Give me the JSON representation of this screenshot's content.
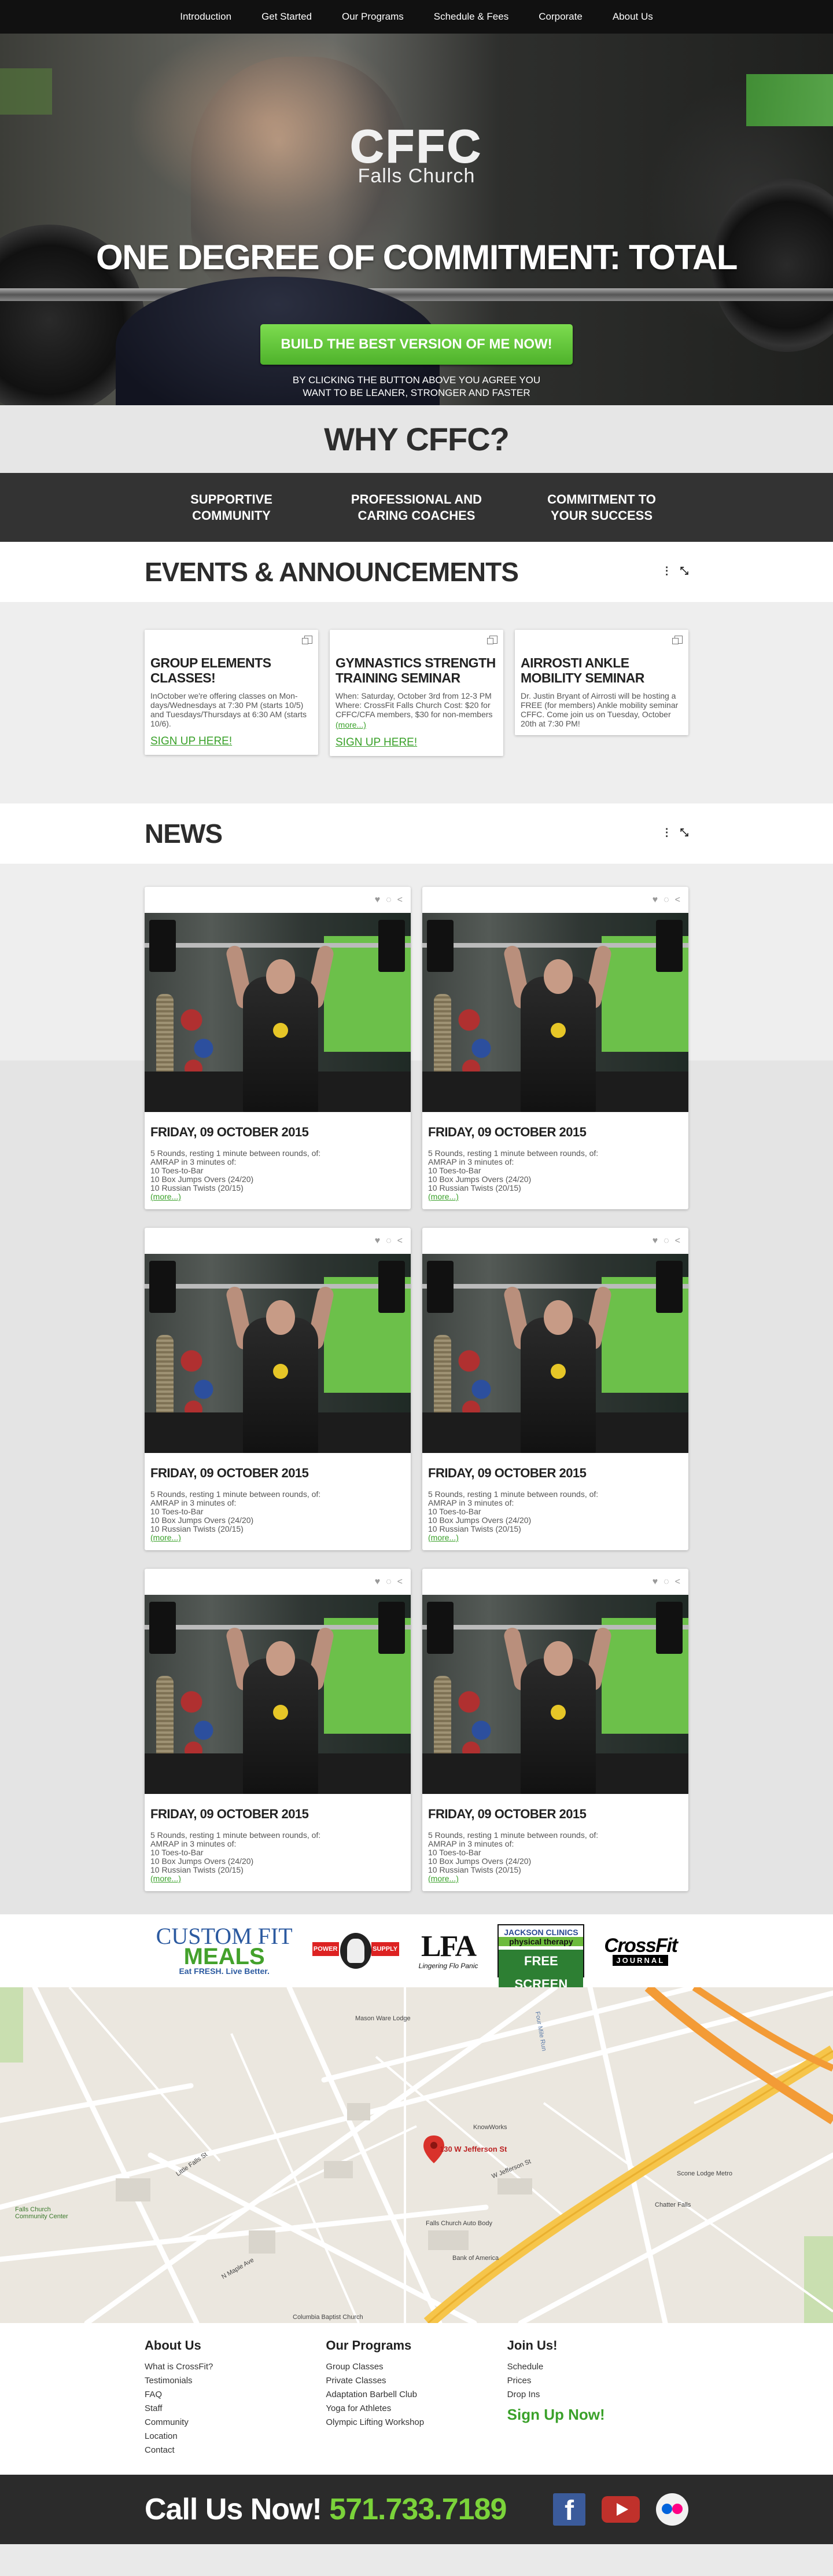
{
  "nav": {
    "items": [
      "Introduction",
      "Get Started",
      "Our Programs",
      "Schedule & Fees",
      "Corporate",
      "About Us"
    ]
  },
  "hero": {
    "logo_letters": "CFFC",
    "logo_sub": "Falls Church",
    "title": "ONE DEGREE OF COMMITMENT: TOTAL",
    "cta": "BUILD THE BEST VERSION OF ME NOW!",
    "note_line1": "BY CLICKING THE BUTTON ABOVE YOU AGREE YOU",
    "note_line2": "WANT TO BE LEANER, STRONGER AND FASTER"
  },
  "why": {
    "title": "WHY CFFC?",
    "pillars": [
      {
        "l1": "SUPPORTIVE",
        "l2": "COMMUNITY"
      },
      {
        "l1": "PROFESSIONAL AND",
        "l2": "CARING COACHES"
      },
      {
        "l1": "COMMITMENT TO",
        "l2": "YOUR SUCCESS"
      }
    ]
  },
  "events": {
    "title": "EVENTS & ANNOUNCEMENTS",
    "items": [
      {
        "title": "GROUP ELEMENTS CLASSES!",
        "body": "InOctober we're offering classes on Mon-days/Wednesdays at 7:30 PM (starts 10/5) and Tuesdays/Thursdays at 6:30 AM (starts 10/6).",
        "more": "",
        "signup": "SIGN UP HERE!"
      },
      {
        "title": "GYMNASTICS STRENGTH TRAINING SEMINAR",
        "body": "When: Saturday, October 3rd from 12-3 PM Where: CrossFit Falls Church Cost: $20 for CFFC/CFA members, $30 for non-members",
        "more": "(more...)",
        "signup": "SIGN UP HERE!"
      },
      {
        "title": "AIRROSTI ANKLE MOBILITY SEMINAR",
        "body": "Dr. Justin Bryant of Airrosti will be hosting a FREE (for members) Ankle mobility seminar CFFC. Come join us on Tuesday, October 20th at 7:30 PM!",
        "more": "",
        "signup": ""
      }
    ]
  },
  "news": {
    "title": "NEWS",
    "posts": [
      {
        "date": "FRIDAY, 09 OCTOBER 2015",
        "l1": "5 Rounds, resting 1 minute between rounds, of:",
        "l2": "AMRAP in 3 minutes of:",
        "l3": "10 Toes-to-Bar",
        "l4": "10 Box Jumps Overs (24/20)",
        "l5": "10 Russian Twists (20/15)",
        "more": "(more...)"
      },
      {
        "date": "FRIDAY, 09 OCTOBER 2015",
        "l1": "5 Rounds, resting 1 minute between rounds, of:",
        "l2": "AMRAP in 3 minutes of:",
        "l3": "10 Toes-to-Bar",
        "l4": "10 Box Jumps Overs (24/20)",
        "l5": "10 Russian Twists (20/15)",
        "more": "(more...)"
      },
      {
        "date": "FRIDAY, 09 OCTOBER 2015",
        "l1": "5 Rounds, resting 1 minute between rounds, of:",
        "l2": "AMRAP in 3 minutes of:",
        "l3": "10 Toes-to-Bar",
        "l4": "10 Box Jumps Overs (24/20)",
        "l5": "10 Russian Twists (20/15)",
        "more": "(more...)"
      },
      {
        "date": "FRIDAY, 09 OCTOBER 2015",
        "l1": "5 Rounds, resting 1 minute between rounds, of:",
        "l2": "AMRAP in 3 minutes of:",
        "l3": "10 Toes-to-Bar",
        "l4": "10 Box Jumps Overs (24/20)",
        "l5": "10 Russian Twists (20/15)",
        "more": "(more...)"
      },
      {
        "date": "FRIDAY, 09 OCTOBER 2015",
        "l1": "5 Rounds, resting 1 minute between rounds, of:",
        "l2": "AMRAP in 3 minutes of:",
        "l3": "10 Toes-to-Bar",
        "l4": "10 Box Jumps Overs (24/20)",
        "l5": "10 Russian Twists (20/15)",
        "more": "(more...)"
      },
      {
        "date": "FRIDAY, 09 OCTOBER 2015",
        "l1": "5 Rounds, resting 1 minute between rounds, of:",
        "l2": "AMRAP in 3 minutes of:",
        "l3": "10 Toes-to-Bar",
        "l4": "10 Box Jumps Overs (24/20)",
        "l5": "10 Russian Twists (20/15)",
        "more": "(more...)"
      }
    ]
  },
  "sponsors": {
    "cfm_a": "CUSTOM FIT",
    "cfm_b": "MEALS",
    "cfm_c": "Eat FRESH. Live Better.",
    "ps_l": "POWER",
    "ps_r": "SUPPLY",
    "lfa_a": "LFA",
    "lfa_b": "Lingering Flo Panic",
    "jc_a": "JACKSON CLINICS",
    "jc_b": "physical therapy",
    "jc_c": "FREE SCREEN",
    "cfj_a": "CrossFit",
    "cfj_b": "JOURNAL"
  },
  "map": {
    "address": "130 W Jefferson St",
    "labels": [
      "Mason Ware Lodge",
      "Falls Church Community Center",
      "Falls Church Auto Body",
      "Bank of America",
      "Columbia Baptist Church",
      "Scone Lodge Metro",
      "Chatter Falls",
      "KnowWorks",
      "Four Mile Run",
      "N Maple Ave",
      "Little Falls St",
      "W Jefferson St"
    ]
  },
  "footer": {
    "about": {
      "title": "About Us",
      "links": [
        "What is CrossFit?",
        "Testimonials",
        "FAQ",
        "Staff",
        "Community",
        "Location",
        "Contact"
      ]
    },
    "programs": {
      "title": "Our Programs",
      "links": [
        "Group Classes",
        "Private Classes",
        "Adaptation Barbell Club",
        "Yoga for Athletes",
        "Olympic Lifting Workshop"
      ]
    },
    "join": {
      "title": "Join Us!",
      "links": [
        "Schedule",
        "Prices",
        "Drop Ins"
      ],
      "cta": "Sign Up Now!"
    },
    "call_label": "Call Us Now!",
    "phone": "571.733.7189"
  }
}
